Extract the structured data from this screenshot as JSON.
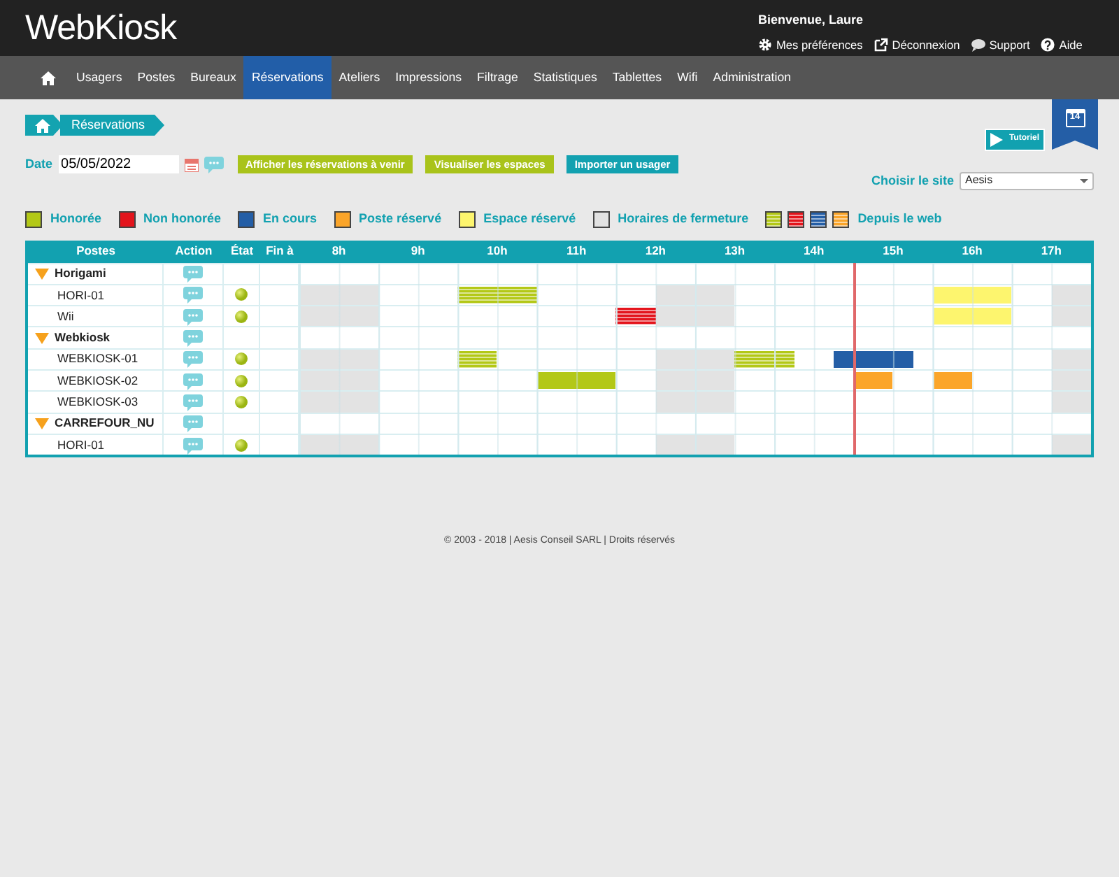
{
  "header": {
    "logo": "WebKiosk",
    "welcome": "Bienvenue, Laure",
    "links": [
      {
        "label": "Mes préférences",
        "kind": "gear"
      },
      {
        "label": "Déconnexion",
        "kind": "external"
      },
      {
        "label": "Support",
        "kind": "chat"
      },
      {
        "label": "Aide",
        "kind": "help"
      }
    ]
  },
  "nav": [
    {
      "kind": "home",
      "selected": false
    },
    {
      "label": "Usagers",
      "selected": false
    },
    {
      "label": "Postes",
      "selected": false
    },
    {
      "label": "Bureaux",
      "selected": false
    },
    {
      "label": "Réservations",
      "selected": true
    },
    {
      "label": "Ateliers",
      "selected": false
    },
    {
      "label": "Impressions",
      "selected": false
    },
    {
      "label": "Filtrage",
      "selected": false
    },
    {
      "label": "Statistiques",
      "selected": false
    },
    {
      "label": "Tablettes",
      "selected": false
    },
    {
      "label": "Wifi",
      "selected": false
    },
    {
      "label": "Administration",
      "selected": false
    }
  ],
  "breadcrumb": {
    "current": "Réservations"
  },
  "calendar_badge": "14",
  "tutorial_button": "Tutoriel",
  "date_filter": {
    "label": "Date",
    "value": "05/05/2022"
  },
  "action_buttons": [
    {
      "label": "Afficher les réservations à venir",
      "kind": "green"
    },
    {
      "label": "Visualiser les espaces",
      "kind": "green"
    },
    {
      "label": "Importer un usager",
      "kind": "teal"
    }
  ],
  "site_select": {
    "label": "Choisir le site",
    "value": "Aesis"
  },
  "legend": [
    {
      "label": "Honorée",
      "color": "#b3c817"
    },
    {
      "label": "Non honorée",
      "color": "#e3141c"
    },
    {
      "label": "En cours",
      "color": "#245ea6"
    },
    {
      "label": "Poste réservé",
      "color": "#fba52a"
    },
    {
      "label": "Espace réservé",
      "color": "#fdf56e"
    },
    {
      "label": "Horaires de fermeture",
      "color": "#e2e2e2"
    }
  ],
  "web_legend": {
    "label": "Depuis le web",
    "swatches": [
      {
        "color": "#b3c817"
      },
      {
        "color": "#e3141c"
      },
      {
        "color": "#245ea6"
      },
      {
        "color": "#fba52a"
      }
    ]
  },
  "table": {
    "columns": [
      "Postes",
      "Action",
      "État",
      "Fin à"
    ],
    "hours": [
      "8h",
      "9h",
      "10h",
      "11h",
      "12h",
      "13h",
      "14h",
      "15h",
      "16h",
      "17h"
    ],
    "now_marker": {
      "level": 0.7
    },
    "groups": [
      {
        "name": "Horigami",
        "expanded": true,
        "children": [
          {
            "name": "HORI-01",
            "active": true,
            "slots": [
              {
                "kind": "closed"
              },
              {
                "kind": "closed"
              },
              {
                "kind": "closed"
              },
              {
                "kind": "closed"
              },
              {
                "kind": "free"
              },
              {
                "kind": "free"
              },
              {
                "kind": "free"
              },
              {
                "kind": "free"
              },
              {
                "kind": "honoree_web"
              },
              {
                "kind": "honoree_web"
              },
              {
                "kind": "honoree_web"
              },
              {
                "kind": "honoree_web"
              },
              {
                "kind": "free"
              },
              {
                "kind": "free"
              },
              {
                "kind": "free"
              },
              {
                "kind": "free"
              },
              {
                "kind": "free"
              },
              {
                "kind": "free"
              },
              {
                "kind": "closed"
              },
              {
                "kind": "closed"
              },
              {
                "kind": "closed"
              },
              {
                "kind": "closed"
              },
              {
                "kind": "free"
              },
              {
                "kind": "free"
              },
              {
                "kind": "free"
              },
              {
                "kind": "free"
              },
              {
                "kind": "free"
              },
              {
                "kind": "free"
              },
              {
                "kind": "free"
              },
              {
                "kind": "free"
              },
              {
                "kind": "free"
              },
              {
                "kind": "free"
              },
              {
                "kind": "espace_reserve"
              },
              {
                "kind": "espace_reserve"
              },
              {
                "kind": "espace_reserve"
              },
              {
                "kind": "espace_reserve"
              },
              {
                "kind": "free"
              },
              {
                "kind": "free"
              },
              {
                "kind": "closed"
              },
              {
                "kind": "closed"
              }
            ]
          },
          {
            "name": "Wii",
            "active": true,
            "slots": [
              {
                "kind": "closed"
              },
              {
                "kind": "closed"
              },
              {
                "kind": "closed"
              },
              {
                "kind": "closed"
              },
              {
                "kind": "free"
              },
              {
                "kind": "free"
              },
              {
                "kind": "free"
              },
              {
                "kind": "free"
              },
              {
                "kind": "free"
              },
              {
                "kind": "free"
              },
              {
                "kind": "free"
              },
              {
                "kind": "free"
              },
              {
                "kind": "free"
              },
              {
                "kind": "free"
              },
              {
                "kind": "free"
              },
              {
                "kind": "free"
              },
              {
                "kind": "non_honoree_web"
              },
              {
                "kind": "non_honoree_web"
              },
              {
                "kind": "closed"
              },
              {
                "kind": "closed"
              },
              {
                "kind": "closed"
              },
              {
                "kind": "closed"
              },
              {
                "kind": "free"
              },
              {
                "kind": "free"
              },
              {
                "kind": "free"
              },
              {
                "kind": "free"
              },
              {
                "kind": "free"
              },
              {
                "kind": "free"
              },
              {
                "kind": "free"
              },
              {
                "kind": "free"
              },
              {
                "kind": "free"
              },
              {
                "kind": "free"
              },
              {
                "kind": "espace_reserve"
              },
              {
                "kind": "espace_reserve"
              },
              {
                "kind": "espace_reserve"
              },
              {
                "kind": "espace_reserve"
              },
              {
                "kind": "free"
              },
              {
                "kind": "free"
              },
              {
                "kind": "closed"
              },
              {
                "kind": "closed"
              }
            ]
          }
        ]
      },
      {
        "name": "Webkiosk",
        "expanded": true,
        "children": [
          {
            "name": "WEBKIOSK-01",
            "active": true,
            "slots": [
              {
                "kind": "closed"
              },
              {
                "kind": "closed"
              },
              {
                "kind": "closed"
              },
              {
                "kind": "closed"
              },
              {
                "kind": "free"
              },
              {
                "kind": "free"
              },
              {
                "kind": "free"
              },
              {
                "kind": "free"
              },
              {
                "kind": "honoree_web"
              },
              {
                "kind": "honoree_web"
              },
              {
                "kind": "free"
              },
              {
                "kind": "free"
              },
              {
                "kind": "free"
              },
              {
                "kind": "free"
              },
              {
                "kind": "free"
              },
              {
                "kind": "free"
              },
              {
                "kind": "free"
              },
              {
                "kind": "free"
              },
              {
                "kind": "closed"
              },
              {
                "kind": "closed"
              },
              {
                "kind": "closed"
              },
              {
                "kind": "closed"
              },
              {
                "kind": "honoree_web"
              },
              {
                "kind": "honoree_web"
              },
              {
                "kind": "honoree_web"
              },
              {
                "kind": "free"
              },
              {
                "kind": "free"
              },
              {
                "kind": "en_cours"
              },
              {
                "kind": "en_cours"
              },
              {
                "kind": "en_cours"
              },
              {
                "kind": "en_cours"
              },
              {
                "kind": "free"
              },
              {
                "kind": "free"
              },
              {
                "kind": "free"
              },
              {
                "kind": "free"
              },
              {
                "kind": "free"
              },
              {
                "kind": "free"
              },
              {
                "kind": "free"
              },
              {
                "kind": "closed"
              },
              {
                "kind": "closed"
              }
            ]
          },
          {
            "name": "WEBKIOSK-02",
            "active": true,
            "slots": [
              {
                "kind": "closed"
              },
              {
                "kind": "closed"
              },
              {
                "kind": "closed"
              },
              {
                "kind": "closed"
              },
              {
                "kind": "free"
              },
              {
                "kind": "free"
              },
              {
                "kind": "free"
              },
              {
                "kind": "free"
              },
              {
                "kind": "free"
              },
              {
                "kind": "free"
              },
              {
                "kind": "free"
              },
              {
                "kind": "free"
              },
              {
                "kind": "honoree"
              },
              {
                "kind": "honoree"
              },
              {
                "kind": "honoree"
              },
              {
                "kind": "honoree"
              },
              {
                "kind": "free"
              },
              {
                "kind": "free"
              },
              {
                "kind": "closed"
              },
              {
                "kind": "closed"
              },
              {
                "kind": "closed"
              },
              {
                "kind": "closed"
              },
              {
                "kind": "free"
              },
              {
                "kind": "free"
              },
              {
                "kind": "free"
              },
              {
                "kind": "free"
              },
              {
                "kind": "free"
              },
              {
                "kind": "free"
              },
              {
                "kind": "poste_reserve"
              },
              {
                "kind": "poste_reserve"
              },
              {
                "kind": "free"
              },
              {
                "kind": "free"
              },
              {
                "kind": "poste_reserve"
              },
              {
                "kind": "poste_reserve"
              },
              {
                "kind": "free"
              },
              {
                "kind": "free"
              },
              {
                "kind": "free"
              },
              {
                "kind": "free"
              },
              {
                "kind": "closed"
              },
              {
                "kind": "closed"
              }
            ]
          },
          {
            "name": "WEBKIOSK-03",
            "active": true,
            "slots": [
              {
                "kind": "closed"
              },
              {
                "kind": "closed"
              },
              {
                "kind": "closed"
              },
              {
                "kind": "closed"
              },
              {
                "kind": "free"
              },
              {
                "kind": "free"
              },
              {
                "kind": "free"
              },
              {
                "kind": "free"
              },
              {
                "kind": "free"
              },
              {
                "kind": "free"
              },
              {
                "kind": "free"
              },
              {
                "kind": "free"
              },
              {
                "kind": "free"
              },
              {
                "kind": "free"
              },
              {
                "kind": "free"
              },
              {
                "kind": "free"
              },
              {
                "kind": "free"
              },
              {
                "kind": "free"
              },
              {
                "kind": "closed"
              },
              {
                "kind": "closed"
              },
              {
                "kind": "closed"
              },
              {
                "kind": "closed"
              },
              {
                "kind": "free"
              },
              {
                "kind": "free"
              },
              {
                "kind": "free"
              },
              {
                "kind": "free"
              },
              {
                "kind": "free"
              },
              {
                "kind": "free"
              },
              {
                "kind": "free"
              },
              {
                "kind": "free"
              },
              {
                "kind": "free"
              },
              {
                "kind": "free"
              },
              {
                "kind": "free"
              },
              {
                "kind": "free"
              },
              {
                "kind": "free"
              },
              {
                "kind": "free"
              },
              {
                "kind": "free"
              },
              {
                "kind": "free"
              },
              {
                "kind": "closed"
              },
              {
                "kind": "closed"
              }
            ]
          }
        ]
      },
      {
        "name": "CARREFOUR_NU",
        "expanded": true,
        "children": [
          {
            "name": "HORI-01",
            "active": true,
            "slots": [
              {
                "kind": "closed"
              },
              {
                "kind": "closed"
              },
              {
                "kind": "closed"
              },
              {
                "kind": "closed"
              },
              {
                "kind": "free"
              },
              {
                "kind": "free"
              },
              {
                "kind": "free"
              },
              {
                "kind": "free"
              },
              {
                "kind": "free"
              },
              {
                "kind": "free"
              },
              {
                "kind": "free"
              },
              {
                "kind": "free"
              },
              {
                "kind": "free"
              },
              {
                "kind": "free"
              },
              {
                "kind": "free"
              },
              {
                "kind": "free"
              },
              {
                "kind": "free"
              },
              {
                "kind": "free"
              },
              {
                "kind": "closed"
              },
              {
                "kind": "closed"
              },
              {
                "kind": "closed"
              },
              {
                "kind": "closed"
              },
              {
                "kind": "free"
              },
              {
                "kind": "free"
              },
              {
                "kind": "free"
              },
              {
                "kind": "free"
              },
              {
                "kind": "free"
              },
              {
                "kind": "free"
              },
              {
                "kind": "free"
              },
              {
                "kind": "free"
              },
              {
                "kind": "free"
              },
              {
                "kind": "free"
              },
              {
                "kind": "free"
              },
              {
                "kind": "free"
              },
              {
                "kind": "free"
              },
              {
                "kind": "free"
              },
              {
                "kind": "free"
              },
              {
                "kind": "free"
              },
              {
                "kind": "closed"
              },
              {
                "kind": "closed"
              }
            ]
          }
        ]
      }
    ]
  },
  "footer": "© 2003 - 2018 | Aesis Conseil SARL | Droits réservés"
}
